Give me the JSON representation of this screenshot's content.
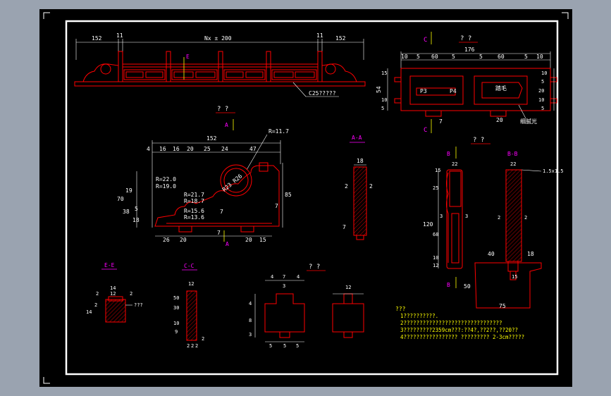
{
  "colors": {
    "background": "#000000",
    "border": "#ffffff",
    "outline": "#ff0000",
    "dimension": "#ffffff",
    "section_label": "#ff00ff",
    "note_text": "#ffff00",
    "hatch": "#ff0000",
    "cutline": "#ffff00"
  },
  "elevation": {
    "dims": [
      "152",
      "11",
      "Nx ± 200",
      "11",
      "152"
    ],
    "label_e": "E",
    "note": "C25?????"
  },
  "plan_c": {
    "title_c": "C",
    "title_q": "? ?",
    "overall": "176",
    "dims": [
      "10",
      "5",
      "60",
      "5",
      "5",
      "60",
      "5",
      "10"
    ],
    "side_dims": [
      "54",
      "15",
      "10",
      "5",
      "10",
      "5",
      "20",
      "10",
      "5"
    ],
    "labels": [
      "P3",
      "P4",
      "踏毛"
    ],
    "bottom_dims": [
      "20",
      "7"
    ],
    "note": "细腻光",
    "bottom_c": "C"
  },
  "panel": {
    "title": "? ?",
    "section_a": "A",
    "section_a2": "A",
    "overall": "152",
    "dims": [
      "4",
      "16",
      "16",
      "20",
      "25",
      "24",
      "47"
    ],
    "radius_top": "R=11.7",
    "radii": [
      "R=22.0",
      "R=19.0",
      "R=21.7",
      "R=18.7",
      "R=15.6",
      "R=13.6"
    ],
    "circle": "R23 R26",
    "left_dims": [
      "70",
      "19",
      "38",
      "5",
      "18"
    ],
    "right_dims": [
      "85",
      "7"
    ],
    "bottom_dims": [
      "26",
      "20",
      "20",
      "15"
    ],
    "misc": [
      "7",
      "7"
    ]
  },
  "section_aa": {
    "title": "A-A",
    "dims": [
      "18",
      "2",
      "2",
      "7"
    ]
  },
  "post": {
    "title": "? ?",
    "section_b": "B",
    "section_bb": "B-B",
    "section_b2": "B",
    "dims": [
      "22",
      "15",
      "25",
      "120",
      "68",
      "10",
      "12",
      "3",
      "3"
    ],
    "chamfer": "1.5x1.5",
    "bb_dims": [
      "22",
      "2",
      "2"
    ],
    "base_dims": [
      "40",
      "18",
      "50",
      "75",
      "15"
    ]
  },
  "section_ee": {
    "title": "E-E",
    "dims": [
      "14",
      "2",
      "12",
      "2",
      "14",
      "2"
    ],
    "note": "???"
  },
  "section_cc": {
    "title": "C-C",
    "dims": [
      "12",
      "50",
      "30",
      "10",
      "9",
      "2",
      "2",
      "2",
      "2"
    ]
  },
  "block": {
    "title": "? ?",
    "top_dims": [
      "4",
      "7",
      "4",
      "3"
    ],
    "side_dims": [
      "4",
      "8",
      "3"
    ],
    "bottom_dims": [
      "5",
      "5",
      "5"
    ],
    "right_dims": [
      "12"
    ]
  },
  "notes": {
    "heading": "???",
    "lines": [
      "1??????????.",
      "2???????????????????????????????",
      "3?????????2359cm???:??4?,??2??,??20??",
      "4?????????????????    ????????? 2-3cm?????"
    ]
  }
}
